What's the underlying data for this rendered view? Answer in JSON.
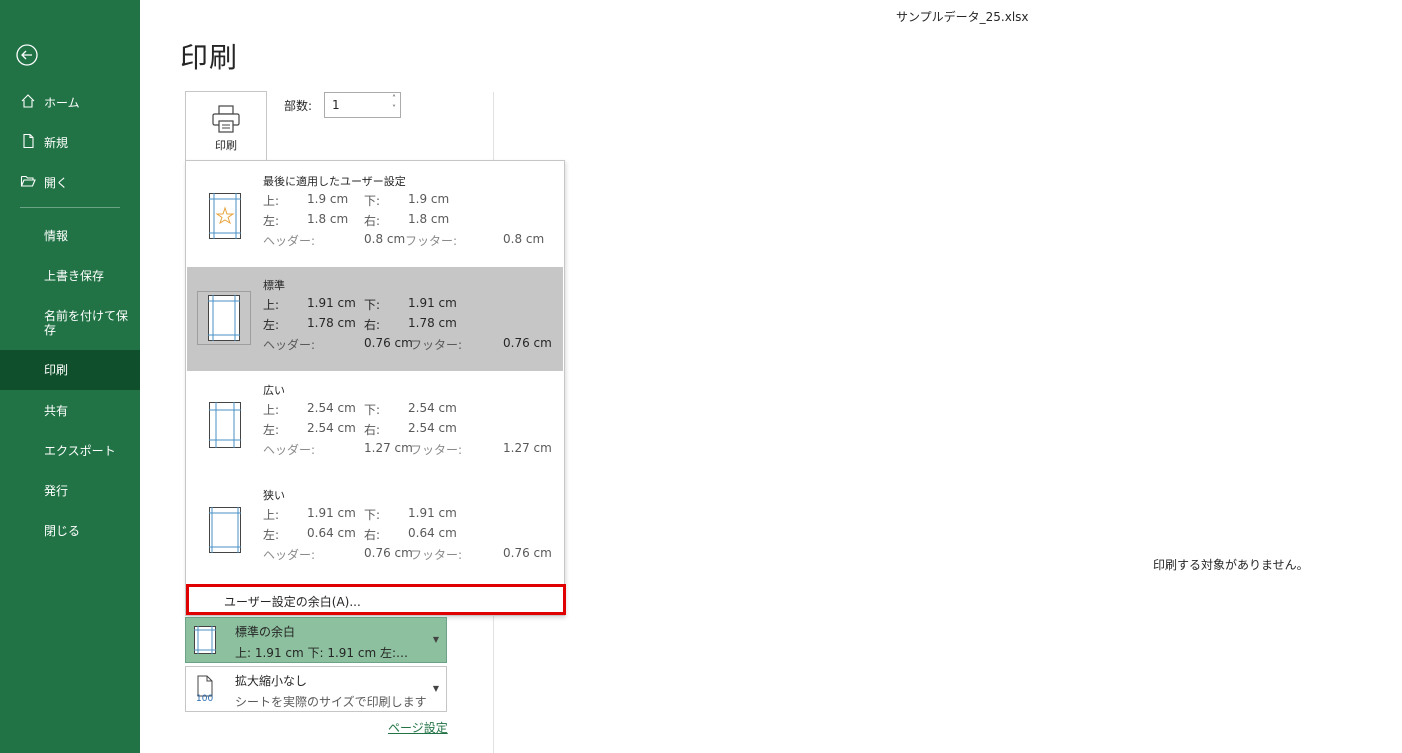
{
  "window": {
    "doc_title": "サンプルデータ_25.xlsx"
  },
  "sidebar": {
    "items": [
      {
        "label": "ホーム",
        "icon": "home-icon"
      },
      {
        "label": "新規",
        "icon": "new-document-icon"
      },
      {
        "label": "開く",
        "icon": "open-folder-icon"
      }
    ],
    "sub_items": [
      {
        "label": "情報"
      },
      {
        "label": "上書き保存"
      },
      {
        "label": "名前を付けて保\n存"
      },
      {
        "label": "印刷",
        "selected": true
      },
      {
        "label": "共有"
      },
      {
        "label": "エクスポート"
      },
      {
        "label": "発行"
      },
      {
        "label": "閉じる"
      }
    ]
  },
  "main": {
    "title": "印刷",
    "print_button_label": "印刷",
    "copies_label": "部数:",
    "copies_value": "1",
    "margin_options": [
      {
        "name": "最後に適用したユーザー設定",
        "top_label": "上:",
        "top": "1.9 cm",
        "bottom_label": "下:",
        "bottom": "1.9 cm",
        "left_label": "左:",
        "left": "1.8 cm",
        "right_label": "右:",
        "right": "1.8 cm",
        "header_label": "ヘッダー:",
        "header": "0.8 cm",
        "footer_label": "フッター:",
        "footer": "0.8 cm"
      },
      {
        "name": "標準",
        "top_label": "上:",
        "top": "1.91 cm",
        "bottom_label": "下:",
        "bottom": "1.91 cm",
        "left_label": "左:",
        "left": "1.78 cm",
        "right_label": "右:",
        "right": "1.78 cm",
        "header_label": "ヘッダー:",
        "header": "0.76 cm",
        "footer_label": "フッター:",
        "footer": "0.76 cm"
      },
      {
        "name": "広い",
        "top_label": "上:",
        "top": "2.54 cm",
        "bottom_label": "下:",
        "bottom": "2.54 cm",
        "left_label": "左:",
        "left": "2.54 cm",
        "right_label": "右:",
        "right": "2.54 cm",
        "header_label": "ヘッダー:",
        "header": "1.27 cm",
        "footer_label": "フッター:",
        "footer": "1.27 cm"
      },
      {
        "name": "狭い",
        "top_label": "上:",
        "top": "1.91 cm",
        "bottom_label": "下:",
        "bottom": "1.91 cm",
        "left_label": "左:",
        "left": "0.64 cm",
        "right_label": "右:",
        "right": "0.64 cm",
        "header_label": "ヘッダー:",
        "header": "0.76 cm",
        "footer_label": "フッター:",
        "footer": "0.76 cm"
      }
    ],
    "custom_margin_label": "ユーザー設定の余白(A)...",
    "margin_setting": {
      "title": "標準の余白",
      "detail": "上: 1.91 cm 下: 1.91 cm 左:…"
    },
    "scale_setting": {
      "title": "拡大縮小なし",
      "detail": "シートを実際のサイズで印刷します",
      "icon_text": "100"
    },
    "page_setup_link": "ページ設定",
    "preview_message": "印刷する対象がありません。"
  },
  "colors": {
    "sidebar_bg": "#217346",
    "sidebar_selected": "#0f4f2b",
    "highlight_border": "#e00000",
    "margin_setting_bg": "#8cc09e"
  }
}
